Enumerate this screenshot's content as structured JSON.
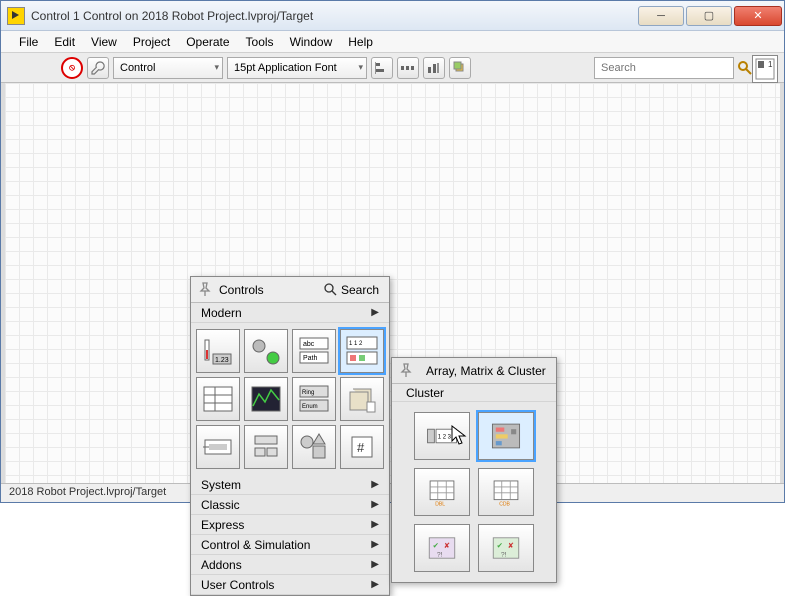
{
  "window": {
    "title": "Control 1 Control on 2018 Robot Project.lvproj/Target"
  },
  "menubar": [
    "File",
    "Edit",
    "View",
    "Project",
    "Operate",
    "Tools",
    "Window",
    "Help"
  ],
  "toolbar": {
    "kind_selector": "Control",
    "font_selector": "15pt Application Font",
    "search_placeholder": "Search",
    "side_badge": "1"
  },
  "palette": {
    "title": "Controls",
    "search_label": "Search",
    "open_category": "Modern",
    "other_categories": [
      "System",
      "Classic",
      "Express",
      "Control & Simulation",
      "Addons",
      "User Controls"
    ],
    "grid_items": [
      {
        "id": "numeric-icon"
      },
      {
        "id": "boolean-icon"
      },
      {
        "id": "string-path-icon"
      },
      {
        "id": "array-matrix-cluster-icon",
        "selected": true
      },
      {
        "id": "list-table-icon"
      },
      {
        "id": "graph-icon"
      },
      {
        "id": "ring-enum-icon"
      },
      {
        "id": "containers-icon"
      },
      {
        "id": "io-icon"
      },
      {
        "id": "variant-class-icon"
      },
      {
        "id": "decorations-icon"
      },
      {
        "id": "refnum-icon"
      }
    ]
  },
  "subpalette": {
    "title": "Array, Matrix & Cluster",
    "highlight": "Cluster",
    "grid_items": [
      {
        "id": "array-icon"
      },
      {
        "id": "cluster-icon",
        "selected": true
      },
      {
        "id": "real-matrix-icon"
      },
      {
        "id": "complex-matrix-icon"
      },
      {
        "id": "error-in-icon"
      },
      {
        "id": "error-out-icon"
      }
    ]
  },
  "statusbar": {
    "text": "2018 Robot Project.lvproj/Target"
  }
}
